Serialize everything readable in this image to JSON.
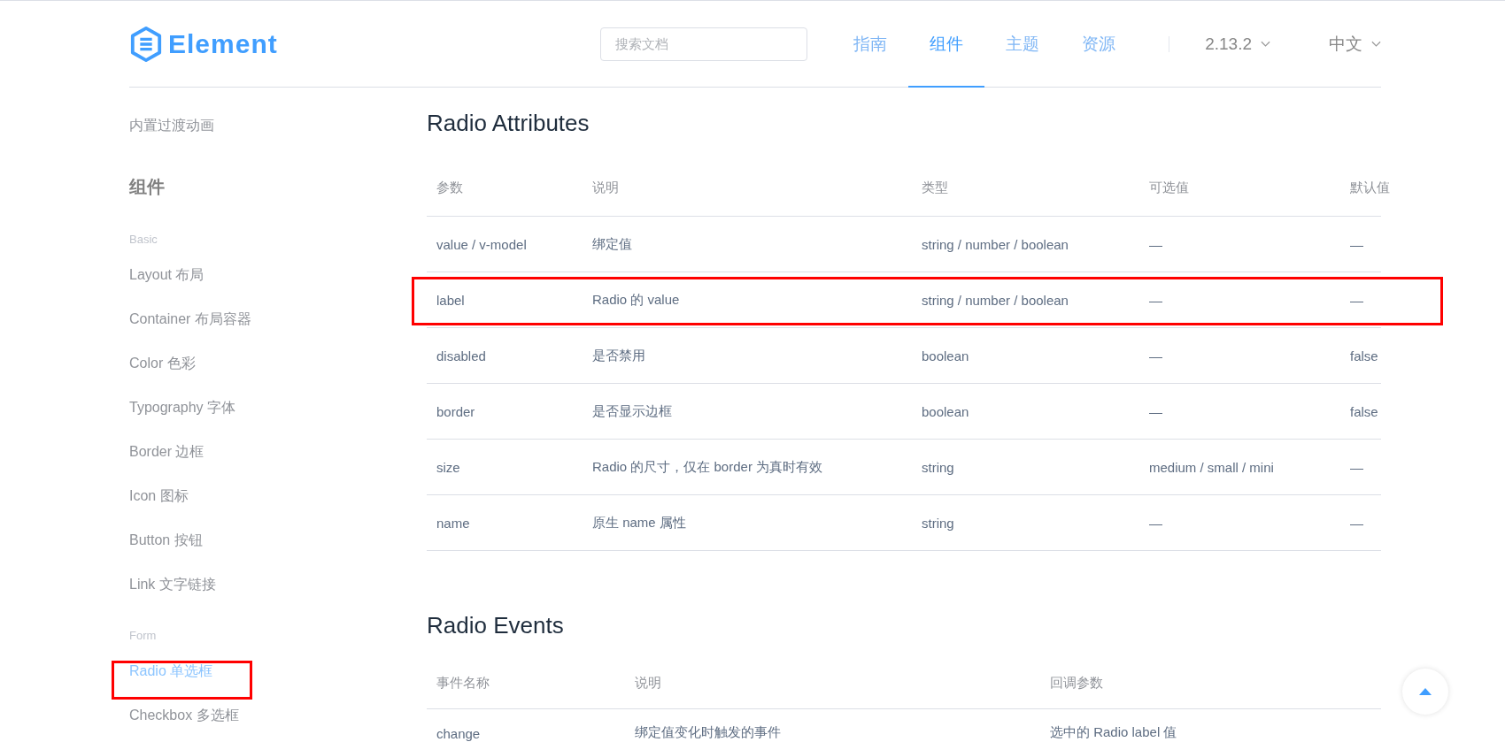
{
  "header": {
    "logo": "Element",
    "search": {
      "placeholder": "搜索文档"
    },
    "nav": [
      {
        "label": "指南",
        "selected": false
      },
      {
        "label": "组件",
        "selected": true
      },
      {
        "label": "主题",
        "selected": false
      },
      {
        "label": "资源",
        "selected": false
      }
    ],
    "version": "2.13.2",
    "language": "中文"
  },
  "sidebar": [
    {
      "kind": "link",
      "label": "内置过渡动画",
      "selected": false,
      "highlighted": false
    },
    {
      "kind": "group",
      "label": "组件"
    },
    {
      "kind": "category",
      "label": "Basic"
    },
    {
      "kind": "link",
      "label": "Layout 布局",
      "selected": false,
      "highlighted": false
    },
    {
      "kind": "link",
      "label": "Container 布局容器",
      "selected": false,
      "highlighted": false
    },
    {
      "kind": "link",
      "label": "Color 色彩",
      "selected": false,
      "highlighted": false
    },
    {
      "kind": "link",
      "label": "Typography 字体",
      "selected": false,
      "highlighted": false
    },
    {
      "kind": "link",
      "label": "Border 边框",
      "selected": false,
      "highlighted": false
    },
    {
      "kind": "link",
      "label": "Icon 图标",
      "selected": false,
      "highlighted": false
    },
    {
      "kind": "link",
      "label": "Button 按钮",
      "selected": false,
      "highlighted": false
    },
    {
      "kind": "link",
      "label": "Link 文字链接",
      "selected": false,
      "highlighted": false
    },
    {
      "kind": "category",
      "label": "Form"
    },
    {
      "kind": "link",
      "label": "Radio 单选框",
      "selected": true,
      "highlighted": true
    },
    {
      "kind": "link",
      "label": "Checkbox 多选框",
      "selected": false,
      "highlighted": false
    }
  ],
  "sections": [
    {
      "title": "Radio Attributes",
      "columns": [
        "参数",
        "说明",
        "类型",
        "可选值",
        "默认值"
      ],
      "rows": [
        {
          "cells": [
            "value / v-model",
            "绑定值",
            "string / number / boolean",
            "—",
            "—"
          ],
          "highlighted": false
        },
        {
          "cells": [
            "label",
            "Radio 的 value",
            "string / number / boolean",
            "—",
            "—"
          ],
          "highlighted": true
        },
        {
          "cells": [
            "disabled",
            "是否禁用",
            "boolean",
            "—",
            "false"
          ],
          "highlighted": false
        },
        {
          "cells": [
            "border",
            "是否显示边框",
            "boolean",
            "—",
            "false"
          ],
          "highlighted": false
        },
        {
          "cells": [
            "size",
            "Radio 的尺寸，仅在 border 为真时有效",
            "string",
            "medium / small / mini",
            "—"
          ],
          "highlighted": false
        },
        {
          "cells": [
            "name",
            "原生 name 属性",
            "string",
            "—",
            "—"
          ],
          "highlighted": false
        }
      ]
    },
    {
      "title": "Radio Events",
      "columns": [
        "事件名称",
        "说明",
        "回调参数"
      ],
      "rows": [
        {
          "cells": [
            "change",
            "绑定值变化时触发的事件",
            "选中的 Radio label 值"
          ],
          "highlighted": false
        }
      ]
    }
  ]
}
